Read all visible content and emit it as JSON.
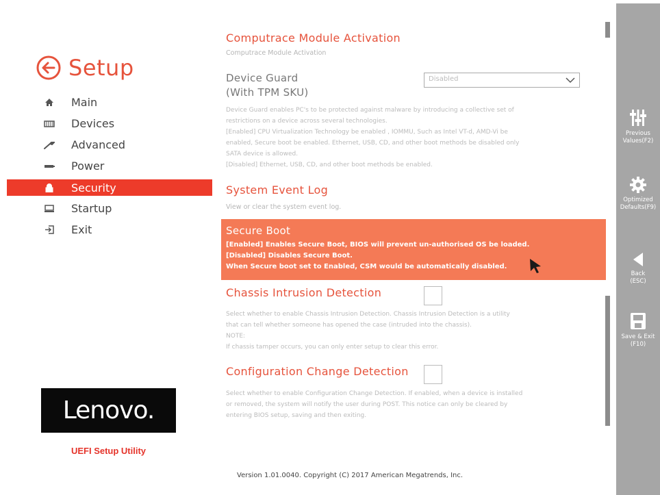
{
  "sidebar": {
    "title": "Setup",
    "items": [
      {
        "label": "Main",
        "icon": "home-icon"
      },
      {
        "label": "Devices",
        "icon": "devices-icon"
      },
      {
        "label": "Advanced",
        "icon": "wrench-icon"
      },
      {
        "label": "Power",
        "icon": "power-icon"
      },
      {
        "label": "Security",
        "icon": "lock-icon",
        "active": true
      },
      {
        "label": "Startup",
        "icon": "startup-icon"
      },
      {
        "label": "Exit",
        "icon": "exit-icon"
      }
    ],
    "brand": "Lenovo.",
    "utility_label": "UEFI Setup Utility"
  },
  "main": {
    "computrace": {
      "title": "Computrace Module Activation",
      "desc": "Computrace Module Activation"
    },
    "device_guard": {
      "title_line1": "Device Guard",
      "title_line2": "(With TPM SKU)",
      "value": "Disabled",
      "desc": [
        "Device Guard enables PC's to be protected against malware by introducing a collective set of",
        "restrictions on a device across several technologies.",
        "[Enabled] CPU Virtualization Technology be enabled , IOMMU, Such as Intel VT-d, AMD-Vi be",
        "enabled, Secure boot be enabled. Ethernet, USB, CD, and other boot methods be disabled only",
        "SATA device is allowed.",
        "[Disabled] Ethernet, USB, CD, and other boot methods be enabled."
      ]
    },
    "system_event_log": {
      "title": "System Event Log",
      "desc": "View or clear the system event log."
    },
    "secure_boot": {
      "title": "Secure Boot",
      "desc": [
        "[Enabled] Enables Secure Boot, BIOS will prevent un-authorised OS be loaded.",
        "[Disabled] Disables Secure Boot.",
        "When Secure boot set to Enabled, CSM would be automatically disabled."
      ]
    },
    "chassis": {
      "title": "Chassis Intrusion Detection",
      "desc": [
        "Select whether to enable Chassis Intrusion Detection. Chassis Intrusion Detection is a utility",
        "that can tell whether someone has opened the case (intruded into the chassis).",
        "NOTE:",
        "If chassis tamper occurs, you can only enter setup to clear this error."
      ]
    },
    "config_change": {
      "title": "Configuration Change Detection",
      "desc": [
        "Select whether to enable Configuration Change Detection.  If enabled, when a device is installed",
        "or removed, the system will notify the user during POST. This notice can only be cleared by",
        "entering BIOS setup, saving and then exiting."
      ]
    }
  },
  "footer": {
    "version": "Version 1.01.0040. Copyright (C) 2017 American Megatrends, Inc."
  },
  "right_panel": {
    "previous": {
      "line1": "Previous",
      "line2": "Values(F2)",
      "icon": "sliders-icon"
    },
    "optimized": {
      "line1": "Optimized",
      "line2": "Defaults(F9)",
      "icon": "gear-icon"
    },
    "back": {
      "line1": "Back",
      "line2": "(ESC)",
      "icon": "back-arrow-icon"
    },
    "save": {
      "line1": "Save & Exit",
      "line2": "(F10)",
      "icon": "save-icon"
    }
  },
  "colors": {
    "accent": "#e6533c",
    "active_nav": "#ed3b2a",
    "selected_row": "#f47a56",
    "right_panel": "#a6a6a6"
  }
}
